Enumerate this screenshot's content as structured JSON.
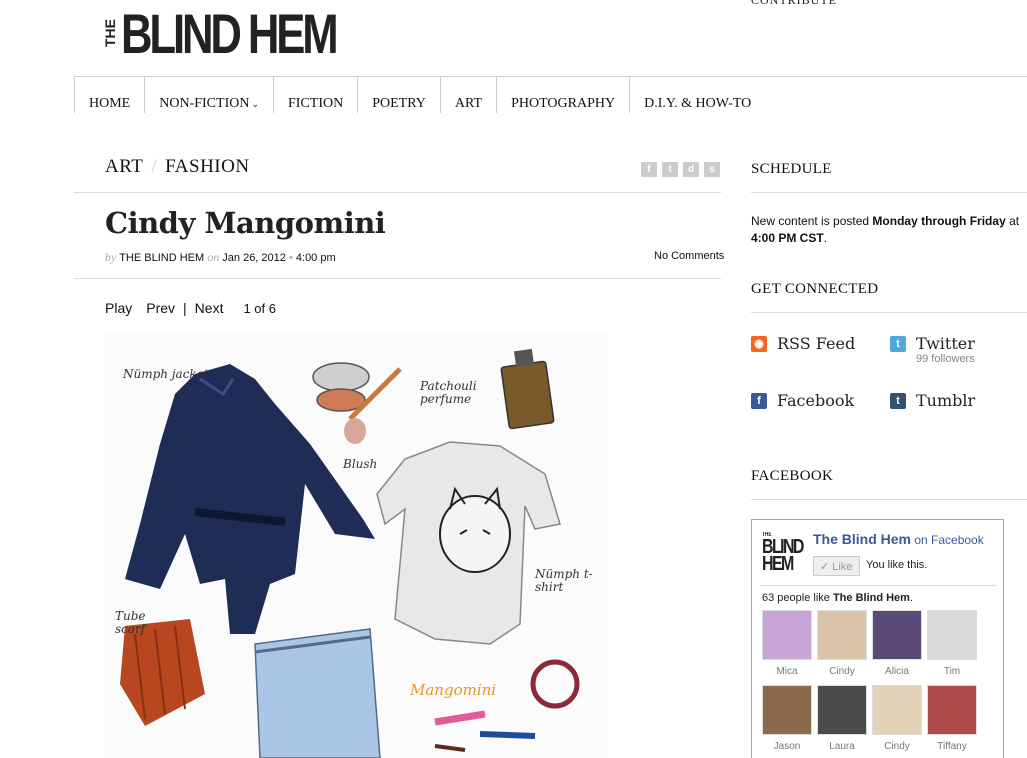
{
  "logo": {
    "the": "THE",
    "main": "BLIND HEM"
  },
  "contribute": "CONTRIBUTE",
  "nav": [
    {
      "label": "HOME"
    },
    {
      "label": "NON-FICTION",
      "has_caret": true
    },
    {
      "label": "FICTION"
    },
    {
      "label": "POETRY"
    },
    {
      "label": "ART"
    },
    {
      "label": "PHOTOGRAPHY"
    },
    {
      "label": "D.I.Y. & HOW-TO"
    }
  ],
  "breadcrumb": {
    "first": "ART",
    "sep": "/",
    "second": "FASHION"
  },
  "share_icons": [
    "facebook-icon",
    "twitter-icon",
    "delicious-icon",
    "stumbleupon-icon"
  ],
  "post": {
    "title": "Cindy Mangomini",
    "by": "by",
    "author": "THE BLIND HEM",
    "on": "on",
    "date": "Jan 26, 2012",
    "bullet": "•",
    "time": "4:00 pm",
    "comments": "No Comments"
  },
  "slideshow": {
    "play": "Play",
    "prev": "Prev",
    "divider": "|",
    "next": "Next",
    "counter": "1 of 6"
  },
  "illustration": {
    "labels": [
      "Nümph jacket",
      "Blush",
      "Patchouli perfume",
      "Nümph t-shirt",
      "Tube scarf",
      "Mangomini"
    ],
    "colors": {
      "jacket": "#1f2c55",
      "scarf": "#b8461e",
      "jeans": "#a9c6e6",
      "tshirt": "#e6e8ea",
      "mangomini": "#e8962a"
    }
  },
  "sidebar": {
    "schedule_heading": "SCHEDULE",
    "schedule_pre": "New content is posted ",
    "schedule_days": "Monday through Friday",
    "schedule_mid": " at ",
    "schedule_time": "4:00 PM CST",
    "schedule_end": ".",
    "connected_heading": "GET CONNECTED",
    "connections": [
      {
        "label": "RSS Feed",
        "icon": "rss-icon",
        "color": "#f26522"
      },
      {
        "label": "Twitter",
        "icon": "twitter-icon",
        "color": "#4fa8d8",
        "sub": "99 followers"
      },
      {
        "label": "Facebook",
        "icon": "facebook-icon",
        "color": "#3b5998"
      },
      {
        "label": "Tumblr",
        "icon": "tumblr-icon",
        "color": "#34526f"
      }
    ],
    "facebook_heading": "FACEBOOK"
  },
  "fb_widget": {
    "logo_lines": [
      "THE",
      "BLIND",
      "HEM"
    ],
    "page_name": "The Blind Hem",
    "on_facebook": " on Facebook",
    "like_button": "Like",
    "you_like": "You like this.",
    "count_pre": "63 people like ",
    "count_page": "The Blind Hem",
    "count_end": ".",
    "fans": [
      {
        "name": "Mica",
        "color": "#c7a5d8"
      },
      {
        "name": "Cindy",
        "color": "#d8c2a8"
      },
      {
        "name": "Alicia",
        "color": "#5a4a7a"
      },
      {
        "name": "Tim",
        "color": "#d9d9d9"
      },
      {
        "name": "Jason",
        "color": "#8a6a4a"
      },
      {
        "name": "Laura",
        "color": "#4a4a4a"
      },
      {
        "name": "Cindy",
        "color": "#e3d1b8"
      },
      {
        "name": "Tiffany",
        "color": "#b04a4a"
      }
    ]
  }
}
